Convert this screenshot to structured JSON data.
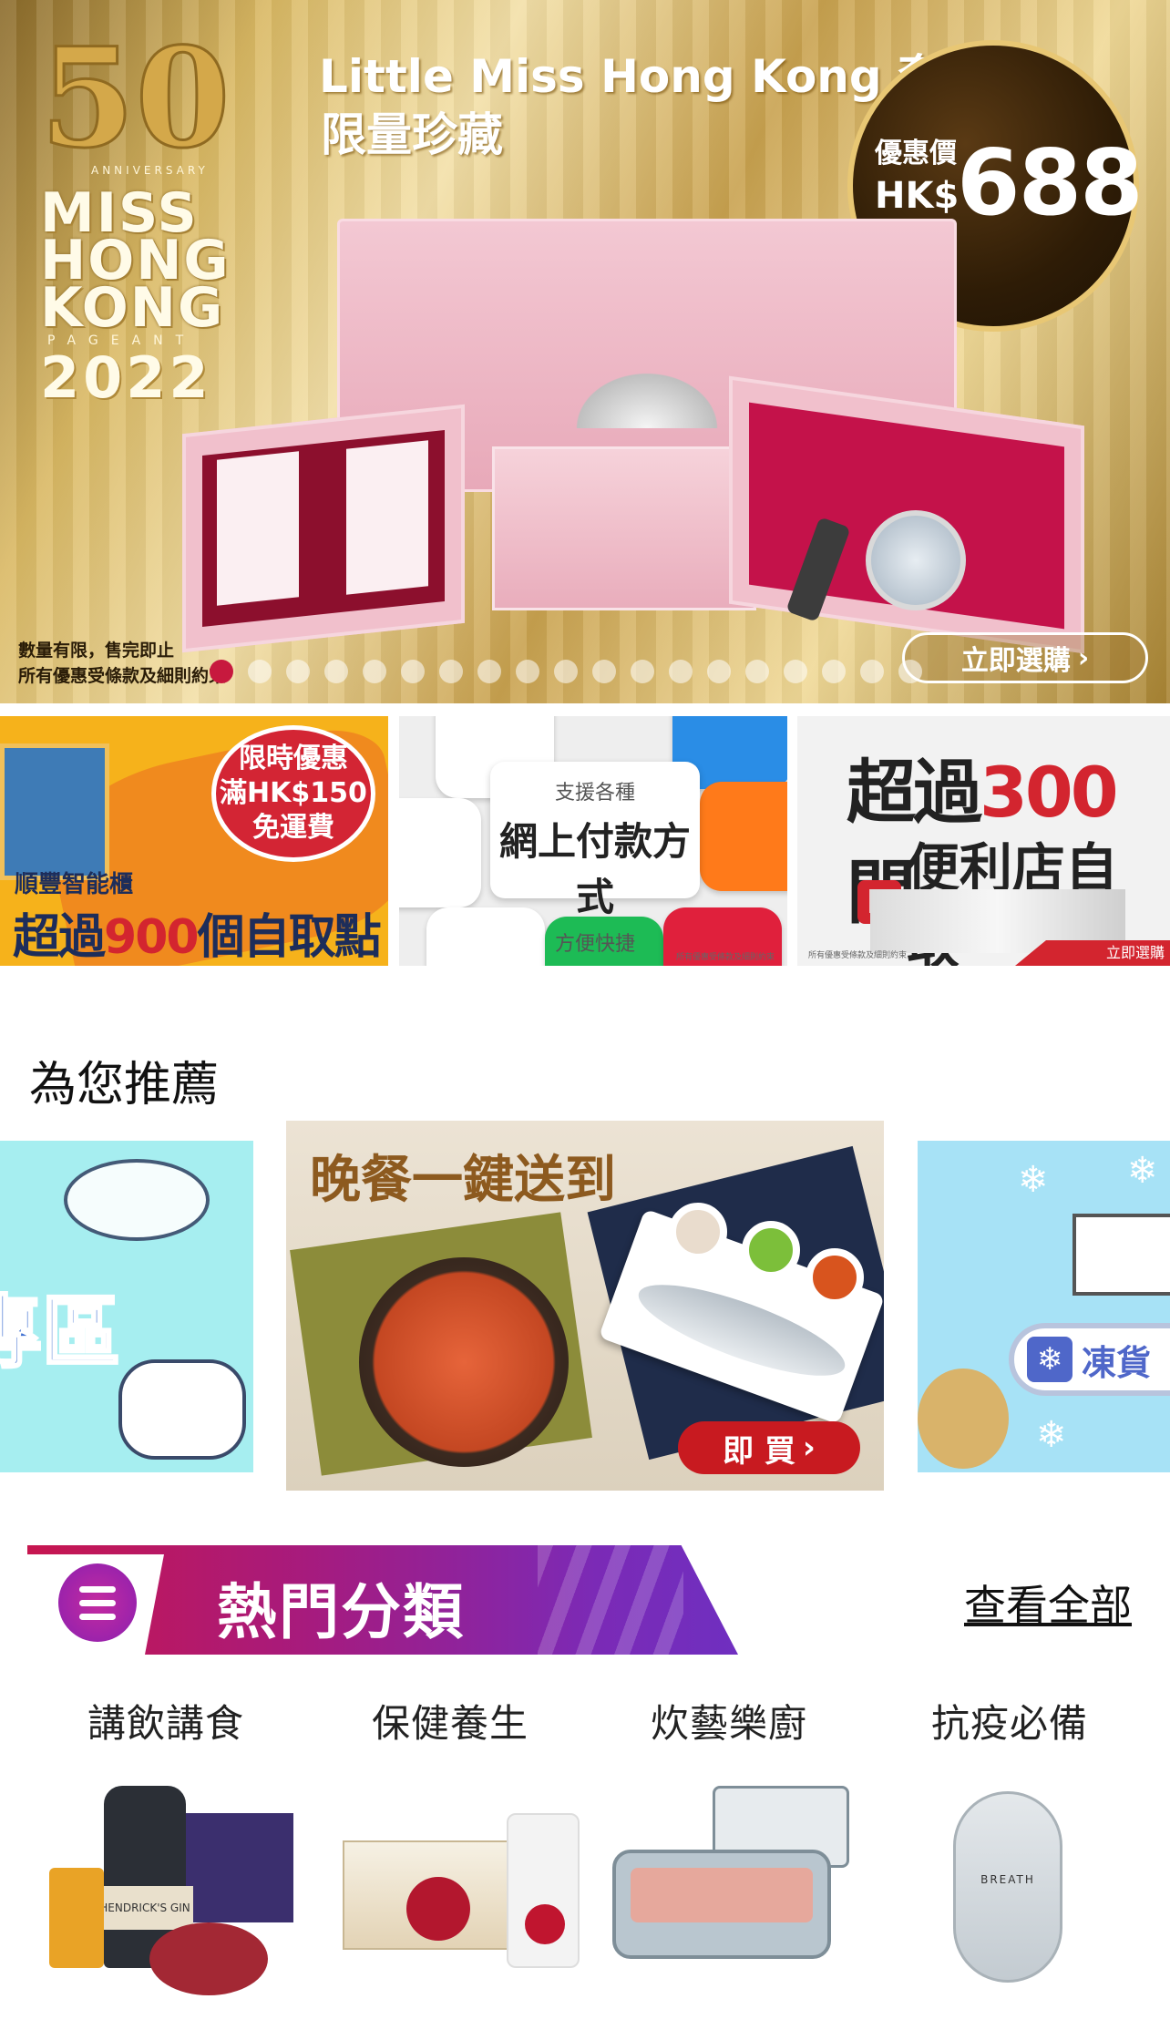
{
  "hero": {
    "logo_number": "50",
    "logo_anniversary": "ANNIVERSARY",
    "logo_lines": [
      "MISS",
      "HONG",
      "KONG"
    ],
    "logo_pageant": "PAGEANT",
    "logo_year": "2022",
    "title_line1": "Little Miss Hong Kong 套裝",
    "title_line2": "限量珍藏",
    "price_label": "優惠價",
    "price_currency": "HK$",
    "price_value": "688",
    "note_line1": "數量有限，售完即止",
    "note_line2": "所有優惠受條款及細則約束",
    "buy_label": "立即選購",
    "carousel": {
      "total": 19,
      "active": 0
    }
  },
  "promos": [
    {
      "badge_line1": "限時優惠",
      "badge_line2": "滿HK$150",
      "badge_line3": "免運費",
      "sub": "順豐智能櫃",
      "head_pre": "超過",
      "head_num": "900",
      "head_post": "個自取點"
    },
    {
      "line1": "支援各種",
      "line2": "網上付款方式",
      "line3": "方便快捷",
      "fine": "所有優惠受條款及細則約束"
    },
    {
      "line1_pre": "超過",
      "line1_num": "300",
      "line1_post": "間",
      "logo": "K",
      "line2": "便利店自取",
      "strip": "立即選購",
      "fine": "所有優惠受條款及細則約束"
    }
  ],
  "recommend": {
    "title": "為您推薦",
    "left_text": "專區",
    "center_head": "晚餐一鍵送到",
    "center_buy": "即 買",
    "right_text": "凍貨",
    "right_snow": "❄"
  },
  "hot": {
    "title": "熱門分類",
    "see_all": "查看全部",
    "categories": [
      {
        "name": "講飲講食"
      },
      {
        "name": "保健養生"
      },
      {
        "name": "炊藝樂廚"
      },
      {
        "name": "抗疫必備"
      }
    ],
    "gin_label": "HENDRICK'S GIN",
    "mask_brand": "BREATH"
  },
  "icons": {
    "chevron": "chevron-right-icon",
    "menu": "menu-icon",
    "snowflake": "snowflake-icon"
  },
  "colors": {
    "accent_red": "#c7193e",
    "hot_purple": "#7b2ab6",
    "gold": "#d9b863"
  }
}
